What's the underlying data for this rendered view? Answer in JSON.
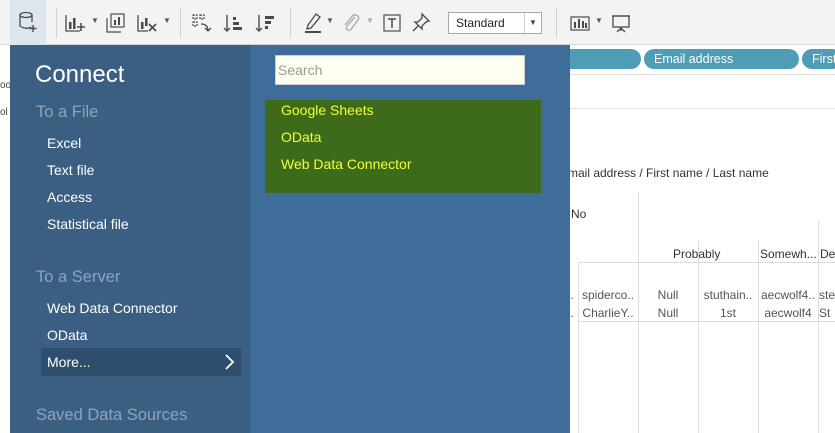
{
  "toolbar": {
    "fit_value": "Standard"
  },
  "connect": {
    "title": "Connect",
    "to_a_file": {
      "heading": "To a File",
      "items": [
        "Excel",
        "Text file",
        "Access",
        "Statistical file"
      ]
    },
    "to_a_server": {
      "heading": "To a Server",
      "items": [
        "Web Data Connector",
        "OData"
      ],
      "more_label": "More..."
    },
    "saved_data_sources": {
      "heading": "Saved Data Sources"
    },
    "search": {
      "placeholder": "Search"
    },
    "results": [
      "Google Sheets",
      "OData",
      "Web Data Connector"
    ]
  },
  "shelf": {
    "pills": [
      "Email address",
      "First"
    ]
  },
  "view": {
    "header_path": "mail address / First name / Last name",
    "row_label_no": "No",
    "col_probably": "Probably",
    "col_somewhat": "Somewh...",
    "col_de": "De",
    "row1": [
      ".",
      "spiderco..",
      "Null",
      "stuthain..",
      "aecwolf4..",
      "ste"
    ],
    "row2": [
      ".",
      "CharlieY..",
      "Null",
      "1st",
      "aecwolf4",
      "St"
    ]
  },
  "left_strip": {
    "fragments": [
      "oo",
      "ol"
    ]
  },
  "colors": {
    "panel_left": "#3b5f82",
    "panel_right": "#3f6d99",
    "results_bg": "#3d6b1a",
    "results_text": "#f0ff3a",
    "pill": "#4e9cb5"
  }
}
